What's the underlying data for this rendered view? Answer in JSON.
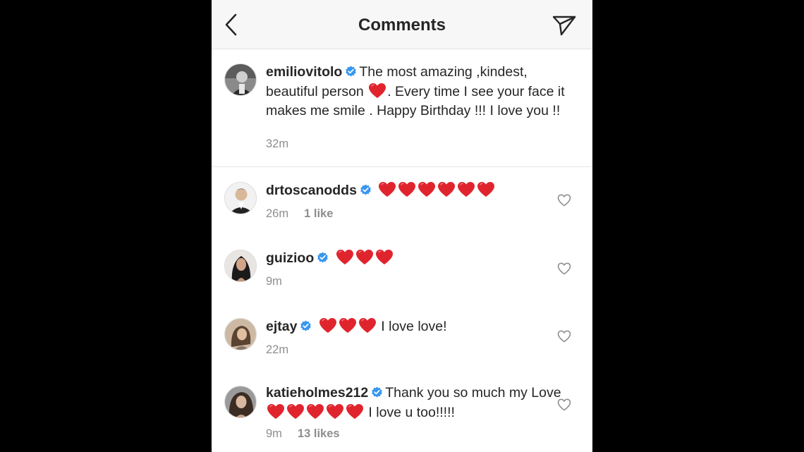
{
  "header": {
    "title": "Comments"
  },
  "caption": {
    "username": "emiliovitolo",
    "text_part1": "The most amazing ,kindest, beautiful  person",
    "text_part2": ". Every time I see your face it makes me smile . Happy Birthday !!! I love you !!",
    "time": "32m"
  },
  "comments": [
    {
      "username": "drtoscanodds",
      "hearts": 6,
      "text": "",
      "time": "26m",
      "likes": "1 like"
    },
    {
      "username": "guizioo",
      "hearts": 3,
      "text": "",
      "time": "9m",
      "likes": ""
    },
    {
      "username": "ejtay",
      "hearts": 3,
      "text": "I love love!",
      "time": "22m",
      "likes": ""
    },
    {
      "username": "katieholmes212",
      "text_before": "Thank you so much my Love",
      "hearts": 5,
      "text": "I love u too!!!!!",
      "time": "9m",
      "likes": "13 likes"
    }
  ],
  "colors": {
    "verified_badge": "#3897f0",
    "heart_emoji": "#e0242e",
    "meta_text": "#8e8e8e",
    "header_bg": "#f7f7f7"
  },
  "icons": {
    "back": "chevron-left-icon",
    "send": "paper-plane-icon",
    "like": "heart-outline-icon",
    "verified": "verified-badge-icon"
  }
}
